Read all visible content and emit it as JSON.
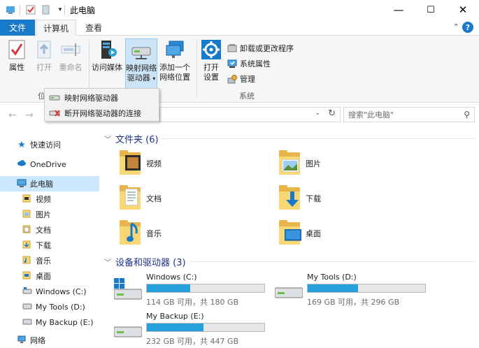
{
  "window": {
    "title": "此电脑",
    "minimize": "—",
    "maximize": "☐",
    "close": "✕"
  },
  "ribbon_tabs": {
    "file": "文件",
    "computer": "计算机",
    "view": "查看",
    "collapse": "⌃",
    "help": "?"
  },
  "ribbon": {
    "properties": "属性",
    "open": "打开",
    "rename": "重命名",
    "access_media": "访问媒体",
    "map_drive_line1": "映射网络",
    "map_drive_line2": "驱动器",
    "add_location_line1": "添加一个",
    "add_location_line2": "网络位置",
    "open_settings_line1": "打开",
    "open_settings_line2": "设置",
    "uninstall": "卸载或更改程序",
    "system_props": "系统属性",
    "manage": "管理",
    "group_location": "位",
    "group_system": "系统"
  },
  "dropdown": {
    "map": "映射网络驱动器",
    "disconnect": "断开网络驱动器的连接"
  },
  "address": {
    "search_placeholder": "搜索\"此电脑\""
  },
  "nav": {
    "quick_access": "快速访问",
    "onedrive": "OneDrive",
    "this_pc": "此电脑",
    "videos": "视频",
    "pictures": "图片",
    "documents": "文档",
    "downloads": "下载",
    "music": "音乐",
    "desktop": "桌面",
    "drive_c": "Windows (C:)",
    "drive_d": "My Tools (D:)",
    "drive_e": "My Backup (E:)",
    "network": "网络"
  },
  "content": {
    "folders_header": "文件夹 (6)",
    "devices_header": "设备和驱动器 (3)",
    "folders": {
      "videos": "视频",
      "pictures": "图片",
      "documents": "文档",
      "downloads": "下载",
      "music": "音乐",
      "desktop": "桌面"
    },
    "drives": [
      {
        "name": "Windows (C:)",
        "free": "114 GB 可用，共 180 GB",
        "used_fraction": 0.367
      },
      {
        "name": "My Tools (D:)",
        "free": "169 GB 可用，共 296 GB",
        "used_fraction": 0.43
      },
      {
        "name": "My Backup (E:)",
        "free": "232 GB 可用，共 447 GB",
        "used_fraction": 0.48
      }
    ]
  },
  "colors": {
    "accent": "#1979ca",
    "drive_fill": "#26a0da",
    "header_text": "#1e3287"
  }
}
